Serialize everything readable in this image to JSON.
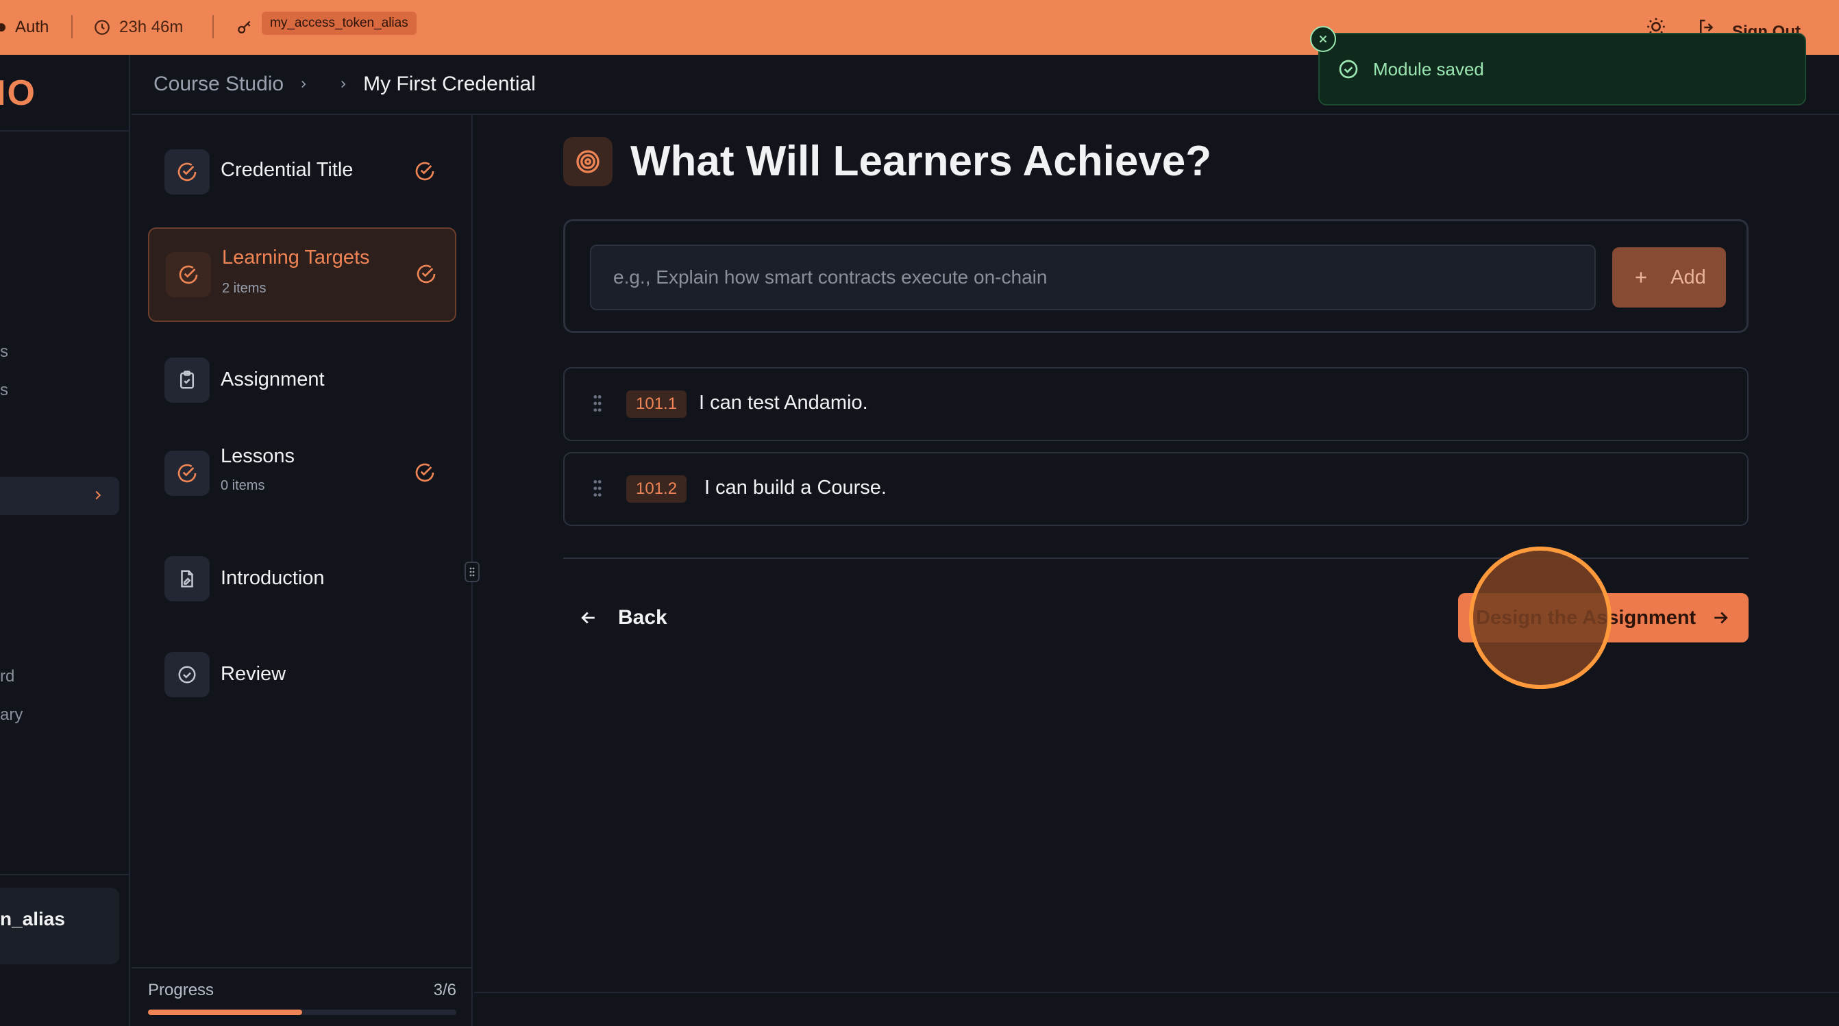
{
  "topbar": {
    "auth_label": "Auth",
    "timer": "23h 46m",
    "token_alias": "my_access_token_alias",
    "sign_out": "Sign Out",
    "accent": "#ef8455"
  },
  "app_sidebar": {
    "logo_fragment": "IO",
    "nav_fragments": [
      "s",
      "s",
      "rd",
      "ary"
    ],
    "user_fragment": "n_alias"
  },
  "breadcrumb": {
    "root": "Course Studio",
    "current": "My First Credential"
  },
  "steps": [
    {
      "title": "Credential Title",
      "sub": "",
      "icon": "check-circle-icon",
      "complete": true,
      "active": false
    },
    {
      "title": "Learning Targets",
      "sub": "2 items",
      "icon": "check-circle-icon",
      "complete": true,
      "active": true
    },
    {
      "title": "Assignment",
      "sub": "",
      "icon": "clipboard-icon",
      "complete": false,
      "active": false
    },
    {
      "title": "Lessons",
      "sub": "0 items",
      "icon": "check-circle-icon",
      "complete": true,
      "active": false
    },
    {
      "title": "Introduction",
      "sub": "",
      "icon": "document-icon",
      "complete": false,
      "active": false
    },
    {
      "title": "Review",
      "sub": "",
      "icon": "circle-check-icon",
      "complete": false,
      "active": false
    }
  ],
  "progress": {
    "label": "Progress",
    "value_text": "3/6",
    "fraction": 0.5
  },
  "main": {
    "title": "What Will Learners Achieve?",
    "input_placeholder": "e.g., Explain how smart contracts execute on-chain",
    "input_value": "",
    "add_label": "Add",
    "targets": [
      {
        "code": "101.1",
        "text": "I can test Andamio."
      },
      {
        "code": "101.2",
        "text": "I can build a Course."
      }
    ],
    "back_label": "Back",
    "next_label": "Design the Assignment"
  },
  "toast": {
    "message": "Module saved",
    "color": "#9be6b2"
  }
}
